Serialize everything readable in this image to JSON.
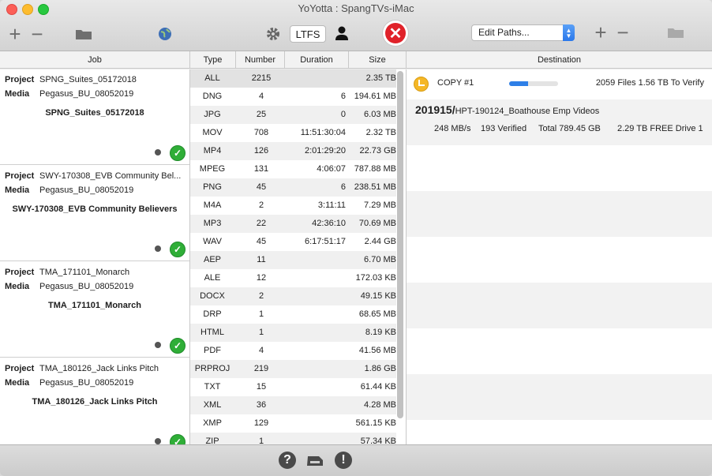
{
  "window": {
    "title": "YoYotta : SpangTVs-iMac"
  },
  "toolbar": {
    "add_label": "+",
    "remove_label": "−",
    "ltfs_label": "LTFS",
    "edit_paths_label": "Edit Paths...",
    "dest_add_label": "+",
    "dest_remove_label": "−",
    "icons": [
      "folder-icon",
      "globe-icon",
      "gear-icon",
      "user-icon",
      "stop-icon"
    ]
  },
  "headers": {
    "job": "Job",
    "type": "Type",
    "number": "Number",
    "duration": "Duration",
    "size": "Size",
    "destination": "Destination"
  },
  "jobs": [
    {
      "project_label": "Project",
      "project": "SPNG_Suites_05172018",
      "media_label": "Media",
      "media": "Pegasus_BU_08052019",
      "name": "SPNG_Suites_05172018"
    },
    {
      "project_label": "Project",
      "project": "SWY-170308_EVB Community Bel...",
      "media_label": "Media",
      "media": "Pegasus_BU_08052019",
      "name": "SWY-170308_EVB Community Believers"
    },
    {
      "project_label": "Project",
      "project": "TMA_171101_Monarch",
      "media_label": "Media",
      "media": "Pegasus_BU_08052019",
      "name": "TMA_171101_Monarch"
    },
    {
      "project_label": "Project",
      "project": "TMA_180126_Jack Links Pitch",
      "media_label": "Media",
      "media": "Pegasus_BU_08052019",
      "name": "TMA_180126_Jack Links Pitch"
    }
  ],
  "types": [
    {
      "type": "ALL",
      "number": "2215",
      "duration": "",
      "size": "2.35 TB"
    },
    {
      "type": "DNG",
      "number": "4",
      "duration": "6",
      "size": "194.61 MB"
    },
    {
      "type": "JPG",
      "number": "25",
      "duration": "0",
      "size": "6.03 MB"
    },
    {
      "type": "MOV",
      "number": "708",
      "duration": "11:51:30:04",
      "size": "2.32 TB"
    },
    {
      "type": "MP4",
      "number": "126",
      "duration": "2:01:29:20",
      "size": "22.73 GB"
    },
    {
      "type": "MPEG",
      "number": "131",
      "duration": "4:06:07",
      "size": "787.88 MB"
    },
    {
      "type": "PNG",
      "number": "45",
      "duration": "6",
      "size": "238.51 MB"
    },
    {
      "type": "M4A",
      "number": "2",
      "duration": "3:11:11",
      "size": "7.29 MB"
    },
    {
      "type": "MP3",
      "number": "22",
      "duration": "42:36:10",
      "size": "70.69 MB"
    },
    {
      "type": "WAV",
      "number": "45",
      "duration": "6:17:51:17",
      "size": "2.44 GB"
    },
    {
      "type": "AEP",
      "number": "11",
      "duration": "",
      "size": "6.70 MB"
    },
    {
      "type": "ALE",
      "number": "12",
      "duration": "",
      "size": "172.03 KB"
    },
    {
      "type": "DOCX",
      "number": "2",
      "duration": "",
      "size": "49.15 KB"
    },
    {
      "type": "DRP",
      "number": "1",
      "duration": "",
      "size": "68.65 MB"
    },
    {
      "type": "HTML",
      "number": "1",
      "duration": "",
      "size": "8.19 KB"
    },
    {
      "type": "PDF",
      "number": "4",
      "duration": "",
      "size": "41.56 MB"
    },
    {
      "type": "PRPROJ",
      "number": "219",
      "duration": "",
      "size": "1.86 GB"
    },
    {
      "type": "TXT",
      "number": "15",
      "duration": "",
      "size": "61.44 KB"
    },
    {
      "type": "XML",
      "number": "36",
      "duration": "",
      "size": "4.28 MB"
    },
    {
      "type": "XMP",
      "number": "129",
      "duration": "",
      "size": "561.15 KB"
    },
    {
      "type": "ZIP",
      "number": "1",
      "duration": "",
      "size": "57.34 KB"
    }
  ],
  "destination": {
    "copy_label": "COPY #1",
    "progress": 0.38,
    "status": "2059 Files 1.56 TB To Verify",
    "path_bold": "201915/",
    "path_rest": "HPT-190124_Boathouse Emp Videos",
    "speed": "248 MB/s",
    "verified": "193 Verified",
    "total": "Total 789.45 GB",
    "free": "2.29 TB FREE Drive 1"
  },
  "bottom": {
    "help_label": "?",
    "alert_label": "!"
  }
}
